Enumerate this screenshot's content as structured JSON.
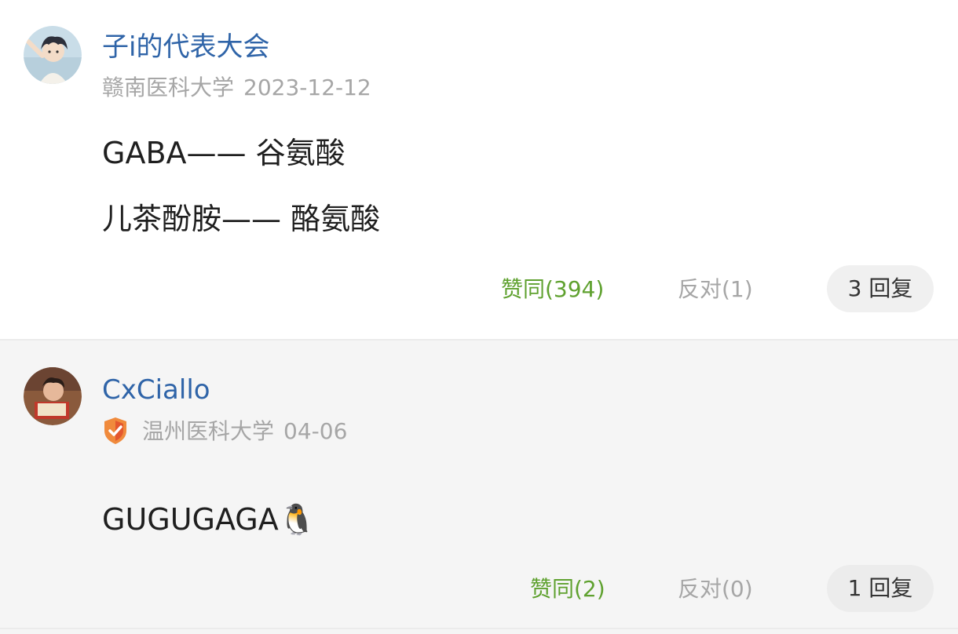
{
  "answers": [
    {
      "author": "子i的代表大会",
      "school": "赣南医科大学",
      "date": "2023-12-12",
      "content": [
        "GABA—— 谷氨酸",
        "儿茶酚胺—— 酪氨酸"
      ],
      "agree_label": "赞同(394)",
      "oppose_label": "反对(1)",
      "reply_label": "3 回复",
      "avatar_icon": "anime-avatar-icon"
    },
    {
      "author": "CxCiallo",
      "school": "温州医科大学",
      "date": "04-06",
      "content": [
        "GUGUGAGA"
      ],
      "content_emoji": "🐧",
      "agree_label": "赞同(2)",
      "oppose_label": "反对(0)",
      "reply_label": "1 回复",
      "avatar_icon": "photo-avatar-icon",
      "badge_icon": "verified-shield-icon"
    }
  ],
  "colors": {
    "author": "#2f64a8",
    "agree": "#5fa12f",
    "meta": "#a6a6a6",
    "badge": "#f08a3c"
  }
}
